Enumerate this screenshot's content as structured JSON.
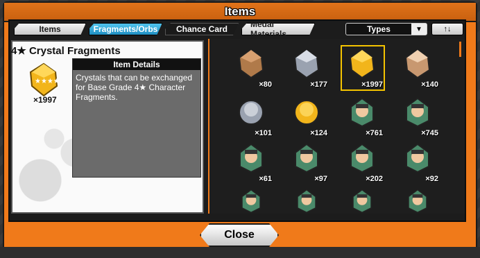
{
  "window": {
    "title": "Items"
  },
  "tabs": [
    {
      "label": "Items",
      "active": false
    },
    {
      "label": "Fragments/Orbs",
      "active": true
    },
    {
      "label": "Chance Card",
      "active": false
    },
    {
      "label": "Medal Materials",
      "active": false
    }
  ],
  "filter": {
    "types_label": "Types",
    "sort_icon": "↑↓"
  },
  "selected_item": {
    "name": "4★ Crystal Fragments",
    "count": "×1997",
    "details_header": "Item Details",
    "description": "Crystals that can be exchanged for Base Grade 4★ Character Fragments."
  },
  "grid": [
    {
      "count": "×80",
      "type": "bronze-crystal"
    },
    {
      "count": "×177",
      "type": "silver-crystal"
    },
    {
      "count": "×1997",
      "type": "gold-crystal",
      "selected": true
    },
    {
      "count": "×140",
      "type": "rainbow-crystal"
    },
    {
      "count": "×101",
      "type": "silver-orb"
    },
    {
      "count": "×124",
      "type": "gold-orb"
    },
    {
      "count": "×761",
      "type": "character-fragment"
    },
    {
      "count": "×745",
      "type": "character-fragment"
    },
    {
      "count": "×61",
      "type": "character-fragment"
    },
    {
      "count": "×97",
      "type": "character-fragment"
    },
    {
      "count": "×202",
      "type": "character-fragment"
    },
    {
      "count": "×92",
      "type": "character-fragment"
    },
    {
      "count": "",
      "type": "character-fragment"
    },
    {
      "count": "",
      "type": "character-fragment"
    },
    {
      "count": "",
      "type": "character-fragment"
    },
    {
      "count": "",
      "type": "character-fragment"
    }
  ],
  "close_label": "Close",
  "colors": {
    "accent": "#f07a1a",
    "active_tab": "#1f8fc2",
    "selection": "#f5c400"
  }
}
